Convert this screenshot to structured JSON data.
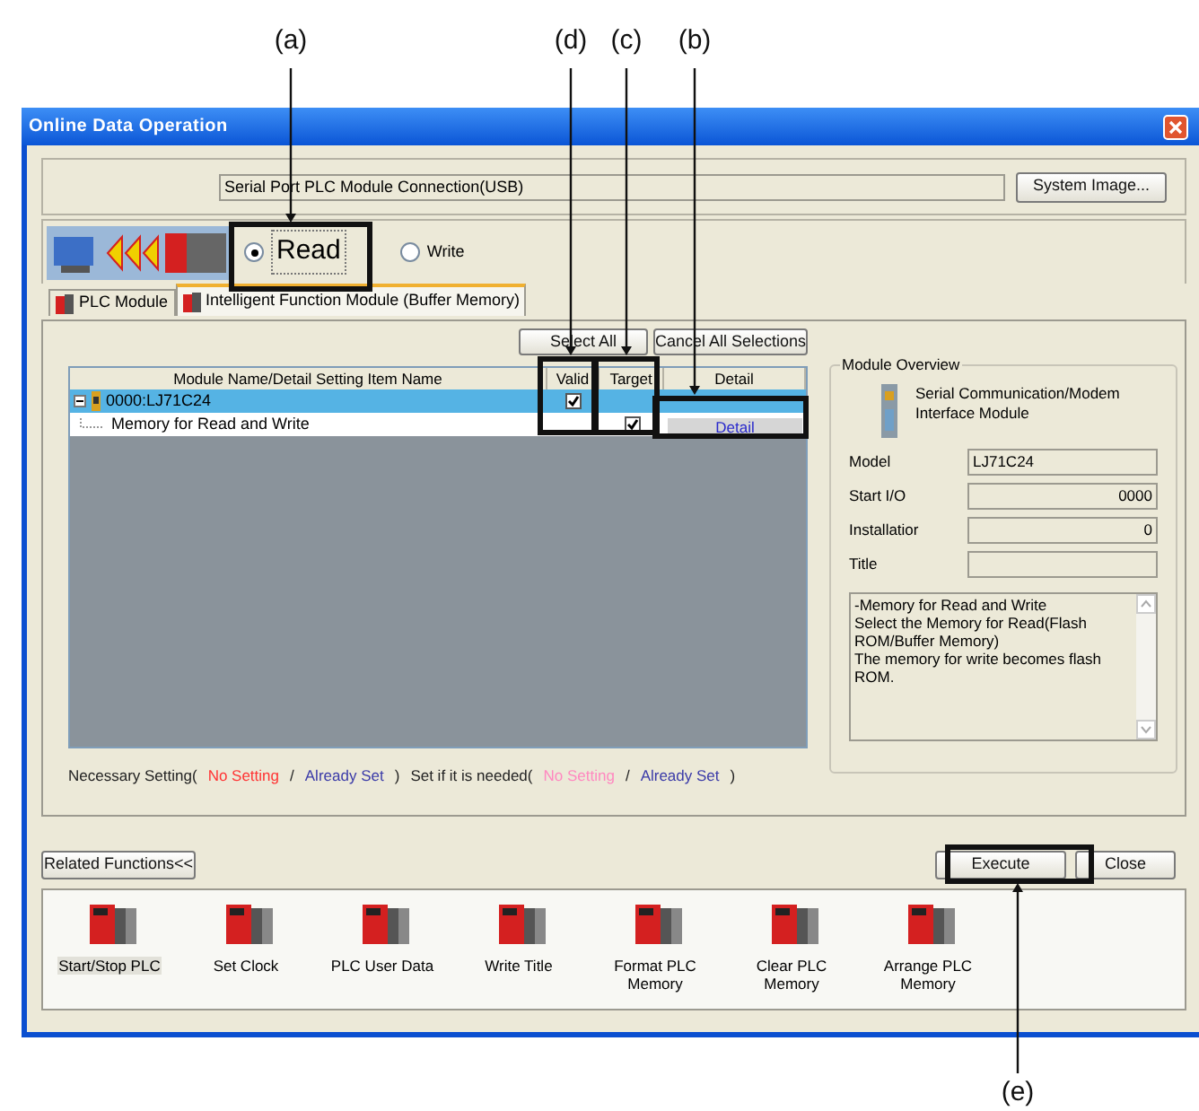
{
  "callouts": [
    {
      "label": "(a)"
    },
    {
      "label": "(d)"
    },
    {
      "label": "(c)"
    },
    {
      "label": "(b)"
    },
    {
      "label": "(e)"
    }
  ],
  "window": {
    "title": "Online Data Operation"
  },
  "connection": {
    "value": "Serial Port  PLC Module Connection(USB)",
    "button": "System Image..."
  },
  "direction": [
    {
      "label": "Read",
      "selected": true
    },
    {
      "label": "Write",
      "selected": false
    }
  ],
  "tabs": [
    {
      "label": "PLC Module",
      "selected": false
    },
    {
      "label": "Intelligent Function Module (Buffer Memory)",
      "selected": true
    }
  ],
  "selection_buttons": [
    "Select All",
    "Cancel All Selections"
  ],
  "table": {
    "columns": [
      "Module Name/Detail Setting Item Name",
      "Valid",
      "Target",
      "Detail"
    ],
    "rows": [
      {
        "name": "0000:LJ71C24",
        "expanded": true,
        "selected": true,
        "valid": true,
        "children": [
          {
            "name": "Memory for Read and Write",
            "selected": false,
            "target": true,
            "detail": "Detail"
          }
        ]
      }
    ]
  },
  "legend": [
    {
      "text": "Necessary Setting(",
      "color": "#222222"
    },
    {
      "text": "No Setting",
      "color": "#ff3333"
    },
    {
      "text": "/",
      "color": "#222222"
    },
    {
      "text": "Already Set",
      "color": "#3a3aa8"
    },
    {
      "text": ")",
      "color": "#222222"
    },
    {
      "text": "Set if it is needed(",
      "color": "#222222"
    },
    {
      "text": "No Setting",
      "color": "#ff88c0"
    },
    {
      "text": "/",
      "color": "#222222"
    },
    {
      "text": "Already Set",
      "color": "#3a3aa8"
    },
    {
      "text": ")",
      "color": "#222222"
    }
  ],
  "module_overview": {
    "title": "Module Overview",
    "module": "Serial Communication/Modem Interface Module",
    "fields": [
      {
        "label": "Model",
        "value": "LJ71C24",
        "kind": "text"
      },
      {
        "label": "Start I/O",
        "value": "0000",
        "kind": "number"
      },
      {
        "label": "Installatior",
        "value": "0",
        "kind": "number"
      },
      {
        "label": "Title",
        "kind": "text"
      }
    ],
    "description": [
      "-Memory for Read and Write",
      "Select the Memory for Read(Flash ROM/Buffer Memory)",
      "The memory for write becomes flash ROM."
    ]
  },
  "related_button": "Related Functions<<",
  "execute_button": "Execute",
  "close_button": "Close",
  "functions": [
    {
      "label": "Start/Stop PLC",
      "selected": true
    },
    {
      "label": "Set Clock",
      "selected": false
    },
    {
      "label": "PLC User Data",
      "selected": false
    },
    {
      "label": "Write Title",
      "selected": false
    },
    {
      "label": "Format PLC Memory",
      "selected": false
    },
    {
      "label": "Clear PLC Memory",
      "selected": false
    },
    {
      "label": "Arrange PLC Memory",
      "selected": false
    }
  ]
}
